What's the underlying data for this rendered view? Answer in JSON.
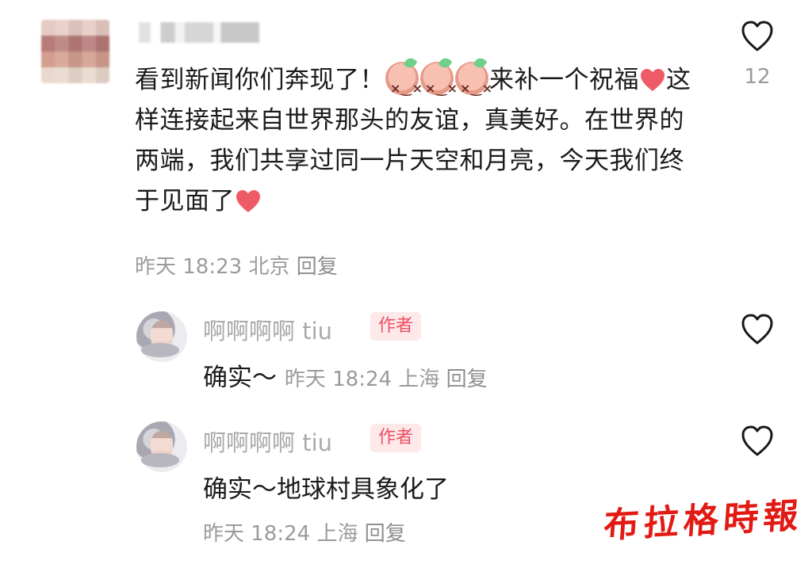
{
  "main_comment": {
    "text_part_1": "看到新闻你们奔现了！",
    "text_part_2": "来补一个祝福",
    "text_part_3": "这样连接起来自世界那头的友谊，真美好。在世界的两端，我们共享过同一片天空和月亮，今天我们终于见面了",
    "time": "昨天 18:23",
    "location": "北京",
    "reply_label": "回复",
    "like_count": "12"
  },
  "replies": [
    {
      "username": "啊啊啊啊 tiu",
      "badge": "作者",
      "text": "确实～",
      "time": "昨天 18:24",
      "location": "上海",
      "reply_label": "回复"
    },
    {
      "username": "啊啊啊啊 tiu",
      "badge": "作者",
      "text": "确实～地球村具象化了",
      "time": "昨天 18:24",
      "location": "上海",
      "reply_label": "回复"
    }
  ],
  "watermark": "布拉格時報",
  "icons": {
    "like": "heart-outline-icon",
    "emoji_sticker": "laughing-character-sticker-icon",
    "heart_emoji": "red-heart-icon"
  },
  "colors": {
    "author_badge_bg": "#fde8ea",
    "author_badge_text": "#ef4f61",
    "watermark": "#e21a13"
  }
}
